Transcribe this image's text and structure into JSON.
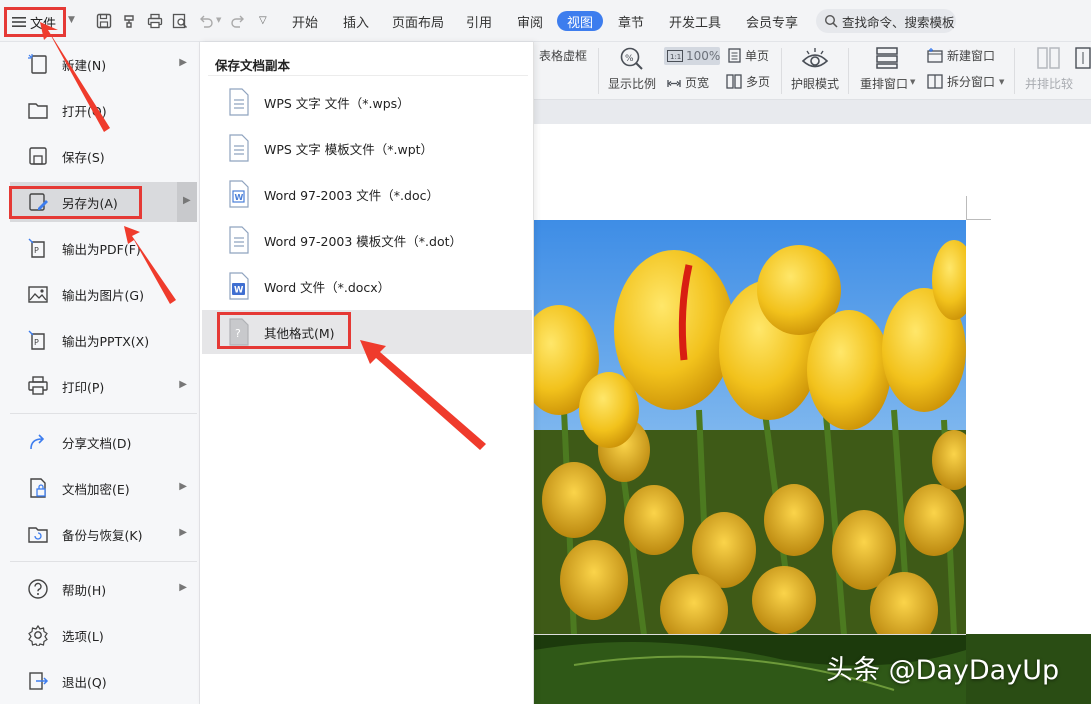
{
  "toolbar": {
    "file_label": "文件",
    "tabs": [
      "开始",
      "插入",
      "页面布局",
      "引用",
      "审阅",
      "视图",
      "章节",
      "开发工具",
      "会员专享"
    ],
    "search_placeholder": "查找命令、搜索模板"
  },
  "ribbon": {
    "table_gridlines": "表格虚框",
    "zoom_ratio": "显示比例",
    "zoom_value": "100%",
    "page_width": "页宽",
    "single_page": "单页",
    "multi_page": "多页",
    "eye_protection": "护眼模式",
    "rearrange_windows": "重排窗口",
    "new_window": "新建窗口",
    "split_window": "拆分窗口",
    "side_by_side": "并排比较"
  },
  "file_menu": {
    "items": [
      {
        "label": "新建(N)",
        "icon": "new-doc-icon",
        "has_arrow": true
      },
      {
        "label": "打开(O)",
        "icon": "folder-open-icon",
        "has_arrow": false
      },
      {
        "label": "保存(S)",
        "icon": "save-icon",
        "has_arrow": false
      },
      {
        "label": "另存为(A)",
        "icon": "save-as-icon",
        "has_arrow": true,
        "selected": true
      },
      {
        "label": "输出为PDF(F)",
        "icon": "export-pdf-icon",
        "has_arrow": false
      },
      {
        "label": "输出为图片(G)",
        "icon": "export-image-icon",
        "has_arrow": false
      },
      {
        "label": "输出为PPTX(X)",
        "icon": "export-pptx-icon",
        "has_arrow": false
      },
      {
        "label": "打印(P)",
        "icon": "print-icon",
        "has_arrow": true
      },
      {
        "label": "分享文档(D)",
        "icon": "share-icon",
        "has_arrow": false
      },
      {
        "label": "文档加密(E)",
        "icon": "encrypt-icon",
        "has_arrow": true
      },
      {
        "label": "备份与恢复(K)",
        "icon": "backup-icon",
        "has_arrow": true
      },
      {
        "label": "帮助(H)",
        "icon": "help-icon",
        "has_arrow": true
      },
      {
        "label": "选项(L)",
        "icon": "settings-icon",
        "has_arrow": false
      },
      {
        "label": "退出(Q)",
        "icon": "exit-icon",
        "has_arrow": false
      }
    ]
  },
  "save_as_panel": {
    "title": "保存文档副本",
    "items": [
      {
        "label": "WPS 文字 文件（*.wps）",
        "icon": "wps-file-icon"
      },
      {
        "label": "WPS 文字 模板文件（*.wpt）",
        "icon": "wps-template-icon"
      },
      {
        "label": "Word 97-2003 文件（*.doc）",
        "icon": "word-doc-icon"
      },
      {
        "label": "Word 97-2003 模板文件（*.dot）",
        "icon": "word-template-icon"
      },
      {
        "label": "Word 文件（*.docx）",
        "icon": "word-docx-icon"
      },
      {
        "label": "其他格式(M)",
        "icon": "other-format-icon",
        "selected": true
      }
    ]
  },
  "watermark": "头条 @DayDayUp",
  "colors": {
    "accent": "#3d7dee",
    "annotation_red": "#e53935",
    "menu_bg": "#f6f7f9",
    "selected_bg": "#d9dadd"
  }
}
